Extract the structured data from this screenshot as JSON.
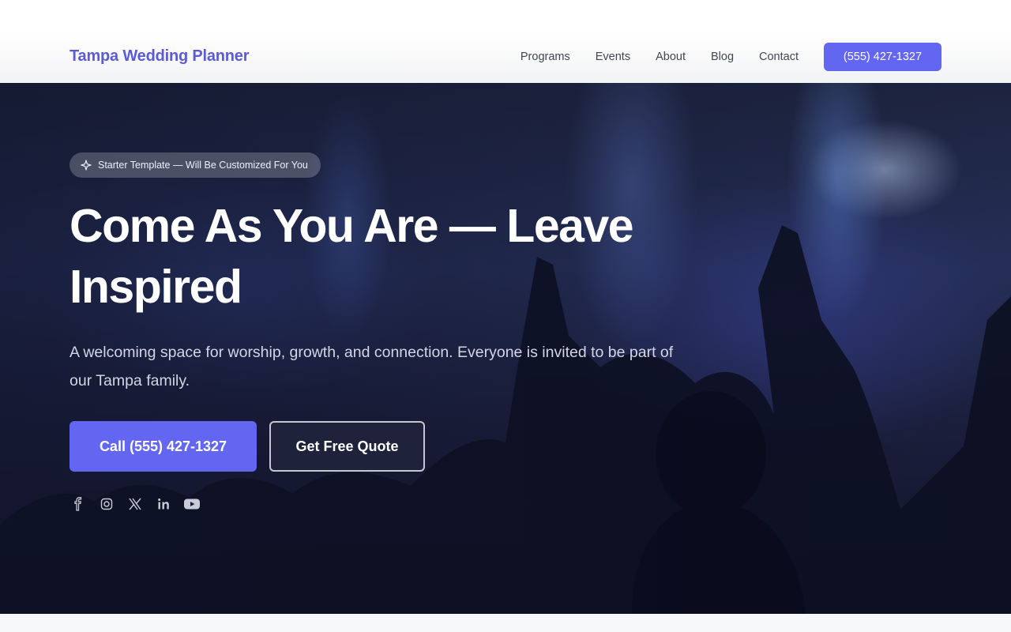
{
  "header": {
    "brand": "Tampa Wedding Planner",
    "nav": [
      "Programs",
      "Events",
      "About",
      "Blog",
      "Contact"
    ],
    "cta_phone": "(555) 427-1327"
  },
  "hero": {
    "badge": "Starter Template — Will Be Customized For You",
    "badge_icon": "sparkle-icon",
    "headline": "Come As You Are — Leave Inspired",
    "subtext": "A welcoming space for worship, growth, and connection. Everyone is invited to be part of our Tampa family.",
    "primary_button": "Call (555) 427-1327",
    "secondary_button": "Get Free Quote",
    "socials": [
      "facebook-icon",
      "instagram-icon",
      "x-icon",
      "linkedin-icon",
      "youtube-icon"
    ]
  },
  "colors": {
    "accent": "#6366f1",
    "brand_text": "#5b5bd6"
  }
}
